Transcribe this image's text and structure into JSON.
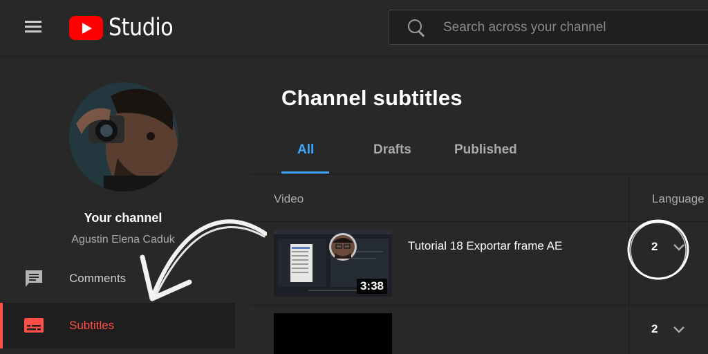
{
  "header": {
    "logo_text": "Studio",
    "search_placeholder": "Search across your channel"
  },
  "sidebar": {
    "channel_title": "Your channel",
    "channel_name": "Agustin Elena Caduk",
    "items": [
      {
        "label": "Comments",
        "icon": "comment-icon",
        "active": false
      },
      {
        "label": "Subtitles",
        "icon": "subtitles-icon",
        "active": true
      }
    ]
  },
  "main": {
    "title": "Channel subtitles",
    "tabs": [
      {
        "label": "All",
        "active": true
      },
      {
        "label": "Drafts",
        "active": false
      },
      {
        "label": "Published",
        "active": false
      }
    ],
    "table": {
      "columns": [
        "Video",
        "Language"
      ],
      "rows": [
        {
          "title": "Tutorial 18 Exportar frame AE",
          "duration": "3:38",
          "languages": "2"
        },
        {
          "title": "",
          "duration": "",
          "languages": "2"
        }
      ]
    }
  },
  "colors": {
    "accent_blue": "#3ea6ff",
    "accent_red": "#ff4e45",
    "background": "#282828",
    "brand_red": "#ff0000"
  }
}
